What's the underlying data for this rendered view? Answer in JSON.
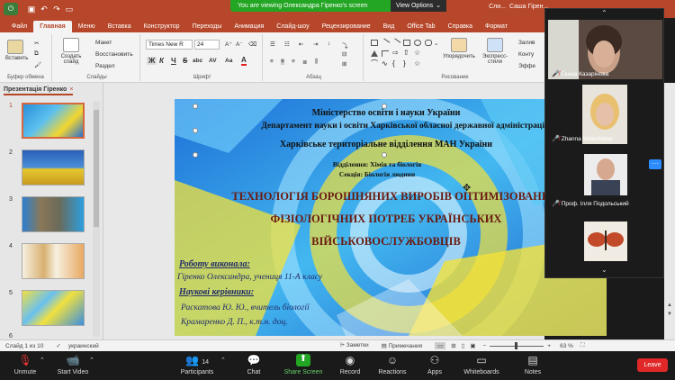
{
  "title_bar": {
    "quick_access": [
      "save-icon",
      "undo-icon",
      "redo-icon",
      "start-from-beginning-icon"
    ],
    "window_title_partial": "Сли...",
    "user_name": "Саша Гірен..."
  },
  "share_banner": {
    "message": "You are viewing Олександра Гіренко's screen",
    "view_options_label": "View Options",
    "view_options_chevron": "⌄"
  },
  "menu_tabs": [
    "Файл",
    "Главная",
    "Меню",
    "Вставка",
    "Конструктор",
    "Переходы",
    "Анимация",
    "Слайд-шоу",
    "Рецензирование",
    "Вид",
    "Office Tab",
    "Справка",
    "Формат"
  ],
  "active_tab": "Главная",
  "ribbon": {
    "clipboard": {
      "paste": "Вставить",
      "group": "Буфер обмена"
    },
    "slides": {
      "new_slide": "Создать слайд",
      "layout": "Макет",
      "reset": "Восстановить",
      "section": "Раздел",
      "group": "Слайды"
    },
    "font": {
      "font_name": "Times New R",
      "font_size": "24",
      "bold": "Ж",
      "italic": "К",
      "underline": "Ч",
      "strike": "S",
      "spacing": "abc",
      "case": "AV",
      "case2": "Aa",
      "color_a": "A",
      "group": "Шрифт"
    },
    "paragraph": {
      "group": "Абзац"
    },
    "drawing": {
      "arrange": "Упорядочить",
      "quick_styles": "Экспресс-стили",
      "fill": "Залив",
      "outline": "Конту",
      "effects": "Эффе",
      "group": "Рисование"
    }
  },
  "slides_pane": {
    "tab_label": "Презентація Гіренко",
    "thumb_numbers": [
      "1",
      "2",
      "3",
      "4",
      "5",
      "6"
    ]
  },
  "slide": {
    "line1": "Міністерство освіти і науки України",
    "line2": "Департамент науки і освіти Харківської обласної державної адміністрації",
    "line3": "Харківське територіальне відділення МАН України",
    "line4": "Відділення: Хімія та біологія",
    "line5": "Секція: Біологія людини",
    "title1": "ТЕХНОЛОГІЯ БОРОШНЯНИХ ВИРОБІВ ОПТИМІЗОВАНИХ",
    "title2": "ФІЗІОЛОГІЧНИХ ПОТРЕБ УКРАЇНСЬКИХ",
    "title3": "ВІЙСЬКОВОСЛУЖБОВЦІВ",
    "author_label": "Роботу виконала:",
    "author": "Гіренко Олександра, учениця 11-А класу",
    "supervisors_label": "Наукові керівники:",
    "supervisor1": "Раскатова Ю. Ю., вчитель біології",
    "supervisor2": "Крамаренко Д. П., к.т.н. доц."
  },
  "status_bar": {
    "slide_counter": "Слайд 1 из 10",
    "language": "украинский",
    "notes": "Заметки",
    "comments": "Примечания",
    "zoom_percent": "63 %",
    "zoom_minus": "−",
    "zoom_plus": "+"
  },
  "gallery": {
    "chevron_up": "⌃",
    "chevron_down": "⌄",
    "participants": [
      {
        "name": "Ганна Казарінова",
        "muted": true
      },
      {
        "name": "Zhanna Meleshkina",
        "muted": true
      },
      {
        "name": "Проф. Ілля Подольський",
        "muted": true
      },
      {
        "name": "",
        "muted": false
      }
    ],
    "more_label": "···"
  },
  "zoom_toolbar": {
    "unmute": "Unmute",
    "start_video": "Start Video",
    "participants": "Participants",
    "participants_count": "14",
    "chat": "Chat",
    "share_screen": "Share Screen",
    "record": "Record",
    "reactions": "Reactions",
    "apps": "Apps",
    "whiteboards": "Whiteboards",
    "notes": "Notes",
    "leave": "Leave"
  },
  "colors": {
    "ppt_accent": "#b7472a",
    "share_green": "#23a623",
    "leave_red": "#e02828",
    "zoom_blue": "#2d8cff"
  }
}
